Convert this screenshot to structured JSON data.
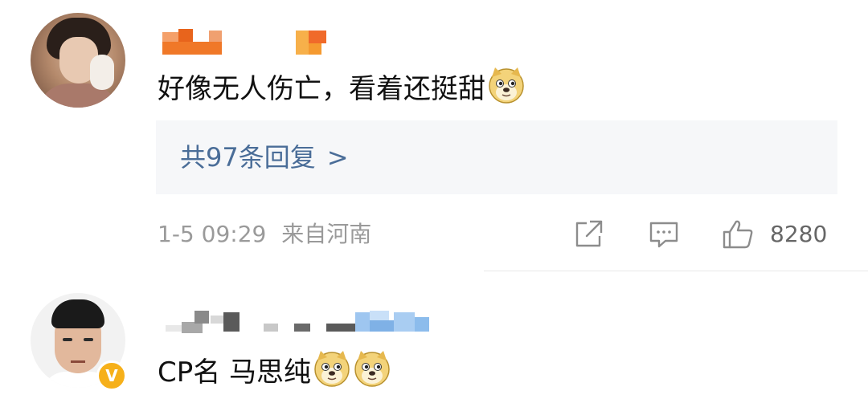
{
  "comments": [
    {
      "text": "好像无人伤亡，看着还挺甜",
      "emojis": [
        "doge-emoji"
      ],
      "reply_link": "共97条回复",
      "reply_arrow": ">",
      "timestamp": "1-5 09:29",
      "location": "来自河南",
      "like_count": "8280"
    },
    {
      "text": "CP名 马思纯",
      "emojis": [
        "doge-emoji",
        "doge-emoji"
      ],
      "verified_badge": "V"
    }
  ],
  "icons": [
    "share-icon",
    "comment-icon",
    "thumbs-up-icon",
    "verified-badge-icon",
    "doge-emoji"
  ],
  "colors": {
    "reply_link": "#4a6d98",
    "reply_box_bg": "#f6f7f9",
    "meta_text": "#9a9a9a",
    "verified_badge": "#f6b01a",
    "username_censor_1": "#f07828",
    "username_censor_2": "#9ec6f0"
  }
}
